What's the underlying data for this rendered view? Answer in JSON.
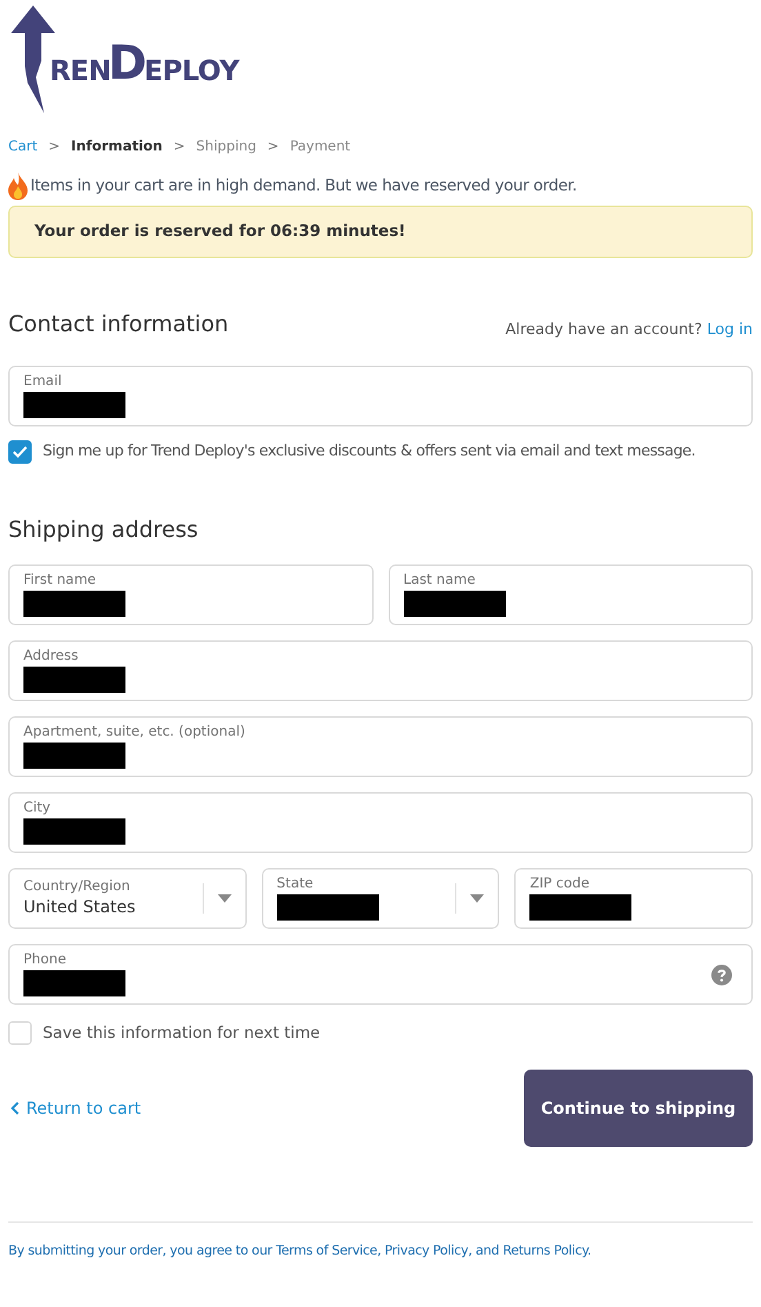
{
  "logo": {
    "parts": [
      "REN",
      "D",
      "EPLOY"
    ]
  },
  "breadcrumb": [
    {
      "label": "Cart",
      "selected": false,
      "kind": "link"
    },
    {
      "label": "Information",
      "selected": true,
      "kind": "step"
    },
    {
      "label": "Shipping",
      "selected": false,
      "kind": "step"
    },
    {
      "label": "Payment",
      "selected": false,
      "kind": "step"
    }
  ],
  "breadcrumb_separator": ">",
  "demand_notice": "Items in your cart are in high demand. But we have reserved your order.",
  "reservation_banner": "Your order is reserved for 06:39 minutes!",
  "contact": {
    "heading": "Contact information",
    "account_prompt": "Already have an account?",
    "login_link": "Log in",
    "email": {
      "label": "Email",
      "kind": "text",
      "redacted": true
    },
    "marketing": {
      "label": "Sign me up for Trend Deploy's exclusive discounts & offers sent via email and text message.",
      "checked": true
    }
  },
  "shipping": {
    "heading": "Shipping address",
    "rows": [
      [
        {
          "label": "First name",
          "kind": "text",
          "redacted": true
        },
        {
          "label": "Last name",
          "kind": "text",
          "redacted": true
        }
      ],
      [
        {
          "label": "Address",
          "kind": "text",
          "redacted": true
        }
      ],
      [
        {
          "label": "Apartment, suite, etc. (optional)",
          "kind": "text",
          "redacted": true
        }
      ],
      [
        {
          "label": "City",
          "kind": "text",
          "redacted": true
        }
      ],
      [
        {
          "label": "Country/Region",
          "kind": "select",
          "value": "United States"
        },
        {
          "label": "State",
          "kind": "select",
          "redacted": true
        },
        {
          "label": "ZIP code",
          "kind": "text",
          "redacted": true
        }
      ],
      [
        {
          "label": "Phone",
          "kind": "help",
          "redacted": true
        }
      ]
    ],
    "save": {
      "label": "Save this information for next time",
      "checked": false
    }
  },
  "actions": {
    "return_link": "Return to cart",
    "continue_button": "Continue to shipping"
  },
  "footer": "By submitting your order, you agree to our Terms of Service, Privacy Policy, and Returns Policy."
}
